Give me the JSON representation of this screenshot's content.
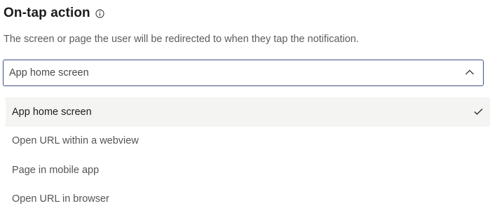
{
  "field": {
    "title": "On-tap action",
    "info_icon": "info-icon",
    "description": "The screen or page the user will be redirected to when they tap the notification."
  },
  "select": {
    "value": "App home screen",
    "icon": "chevron-up-icon",
    "border_color": "#3e4f86"
  },
  "options": [
    {
      "label": "App home screen",
      "selected": true
    },
    {
      "label": "Open URL within a webview",
      "selected": false
    },
    {
      "label": "Page in mobile app",
      "selected": false
    },
    {
      "label": "Open URL in browser",
      "selected": false
    }
  ],
  "colors": {
    "selected_bg": "#f4f4f2",
    "text_primary": "#1c1c1c",
    "text_secondary": "#555555"
  }
}
